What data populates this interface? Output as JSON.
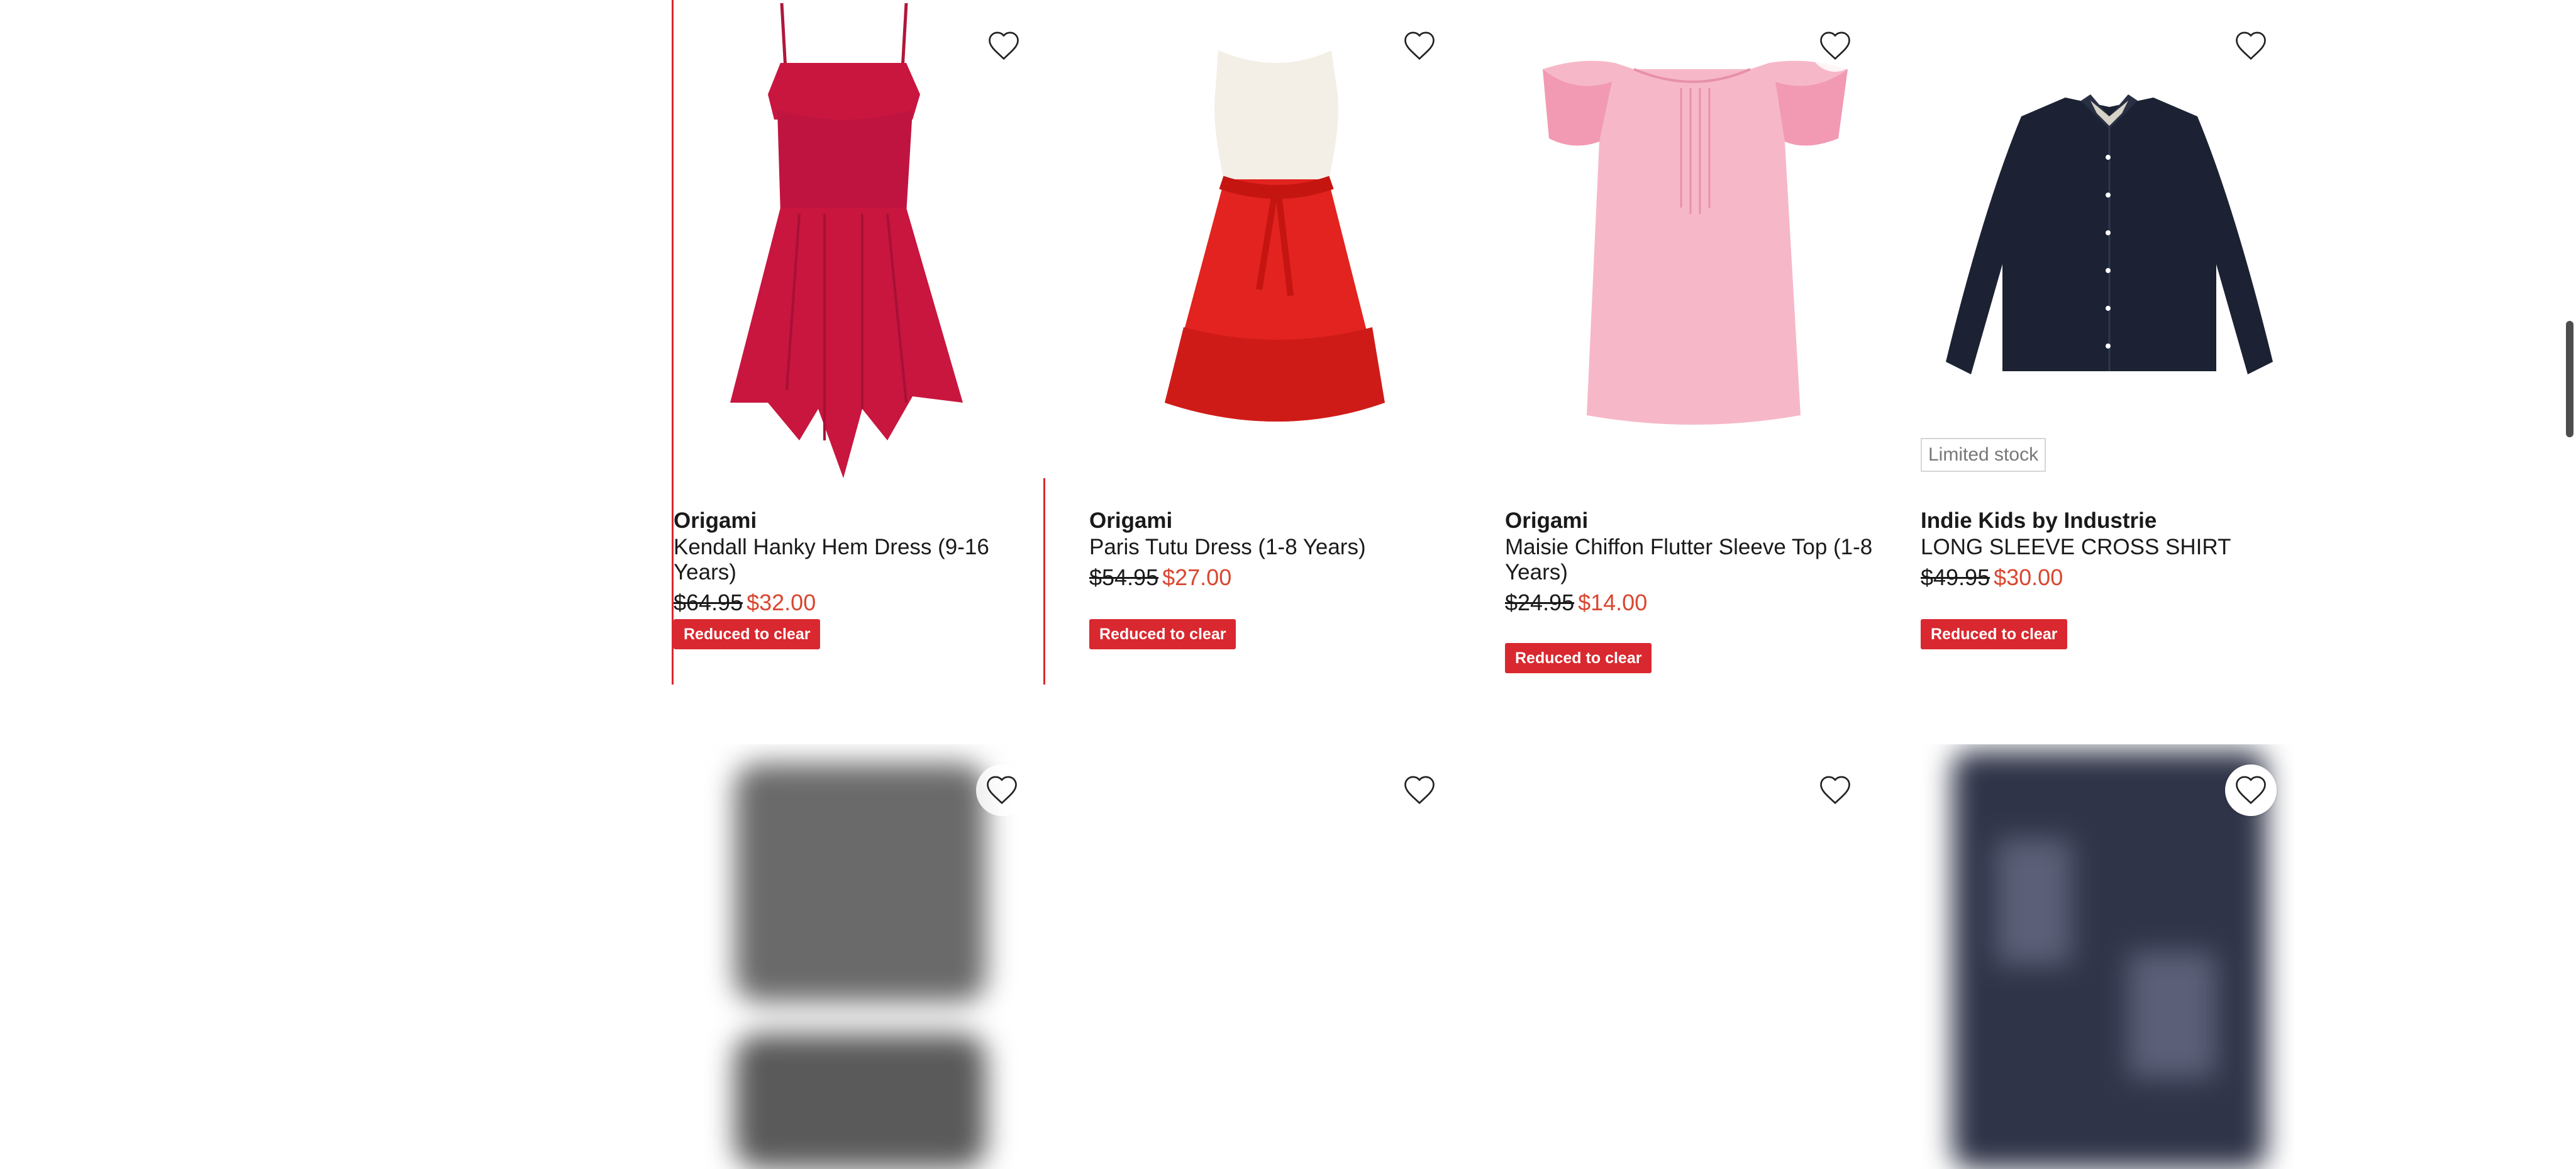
{
  "products": [
    {
      "brand": "Origami",
      "name": "Kendall Hanky Hem Dress (9-16 Years)",
      "was_price": "$64.95",
      "now_price": "$32.00",
      "badge": "Reduced to clear"
    },
    {
      "brand": "Origami",
      "name": "Paris Tutu Dress (1-8 Years)",
      "was_price": "$54.95",
      "now_price": "$27.00",
      "badge": "Reduced to clear"
    },
    {
      "brand": "Origami",
      "name": "Maisie Chiffon Flutter Sleeve Top (1-8 Years)",
      "was_price": "$24.95",
      "now_price": "$14.00",
      "badge": "Reduced to clear"
    },
    {
      "brand": "Indie Kids by Industrie",
      "name": "LONG SLEEVE CROSS SHIRT",
      "was_price": "$49.95",
      "now_price": "$30.00",
      "badge": "Reduced to clear",
      "stock_label": "Limited stock"
    }
  ],
  "colors": {
    "accent_red": "#d9282f",
    "sale_price": "#d9462f"
  },
  "icons": {
    "wishlist": "heart-outline-icon"
  }
}
